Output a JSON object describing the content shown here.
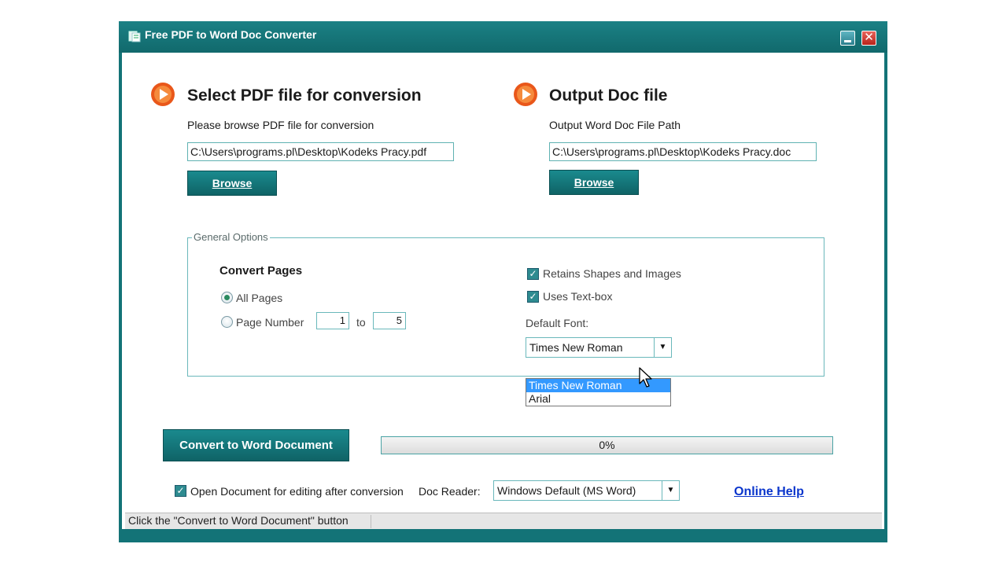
{
  "window": {
    "title": "Free PDF to Word Doc Converter",
    "accent_color": "#137377",
    "controls": {
      "minimize_icon": "minimize-icon",
      "close_label": "✕"
    }
  },
  "input_section": {
    "heading": "Select PDF file for conversion",
    "subtitle": "Please browse PDF file for conversion",
    "path_value": "C:\\Users\\programs.pl\\Desktop\\Kodeks Pracy.pdf",
    "browse_label": "Browse",
    "icon": "orange-play-icon"
  },
  "output_section": {
    "heading": "Output Doc file",
    "subtitle": "Output Word Doc File Path",
    "path_value": "C:\\Users\\programs.pl\\Desktop\\Kodeks Pracy.doc",
    "browse_label": "Browse",
    "icon": "orange-play-icon"
  },
  "general_options": {
    "legend": "General Options",
    "convert_pages_label": "Convert Pages",
    "all_pages_label": "All Pages",
    "all_pages_selected": true,
    "page_number_label": "Page Number",
    "page_from": "1",
    "to_label": "to",
    "page_to": "5",
    "retains_shapes_label": "Retains Shapes and Images",
    "retains_shapes_checked": true,
    "uses_textbox_label": "Uses Text-box",
    "uses_textbox_checked": true,
    "default_font_label": "Default Font:",
    "default_font_value": "Times New Roman",
    "font_options": [
      "Times New Roman",
      "Arial"
    ],
    "font_option_highlighted": "Times New Roman"
  },
  "actions": {
    "convert_label": "Convert to Word Document",
    "progress_text": "0%",
    "progress_fraction": 0
  },
  "footer": {
    "open_doc_label": "Open Document for editing after conversion",
    "open_doc_checked": true,
    "doc_reader_label": "Doc Reader:",
    "doc_reader_value": "Windows Default (MS Word)",
    "online_help_label": "Online Help"
  },
  "status_bar": {
    "text": "Click the \"Convert to Word Document\" button"
  }
}
